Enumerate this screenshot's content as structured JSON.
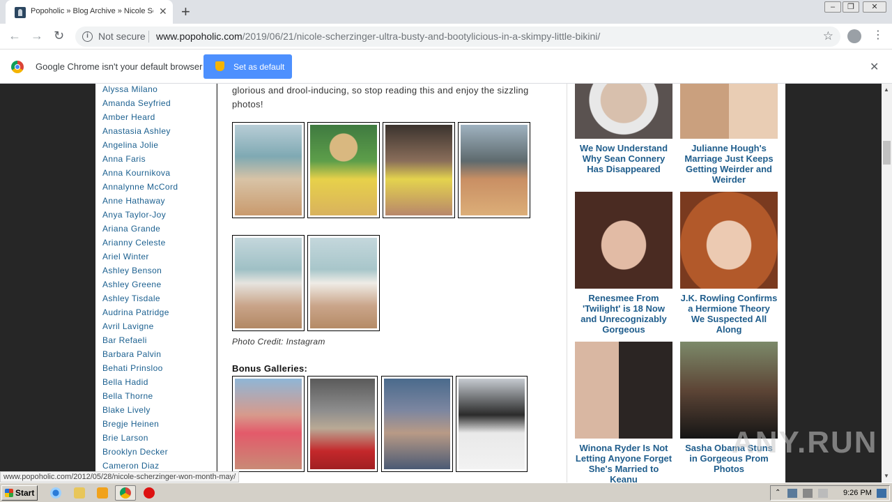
{
  "browser": {
    "tab_title": "Popoholic » Blog Archive » Nicole Scherzinger",
    "new_tab_symbol": "+",
    "close_symbol": "✕",
    "security_text": "Not secure",
    "url_domain": "www.popoholic.com",
    "url_path": "/2019/06/21/nicole-scherzinger-ultra-busty-and-bootylicious-in-a-skimpy-little-bikini/"
  },
  "infobar": {
    "message": "Google Chrome isn't your default browser",
    "button_label": "Set as default"
  },
  "sidebar": {
    "items": [
      "Alyssa Milano",
      "Amanda Seyfried",
      "Amber Heard",
      "Anastasia Ashley",
      "Angelina Jolie",
      "Anna Faris",
      "Anna Kournikova",
      "Annalynne McCord",
      "Anne Hathaway",
      "Anya Taylor-Joy",
      "Ariana Grande",
      "Arianny Celeste",
      "Ariel Winter",
      "Ashley Benson",
      "Ashley Greene",
      "Ashley Tisdale",
      "Audrina Patridge",
      "Avril Lavigne",
      "Bar Refaeli",
      "Barbara Palvin",
      "Behati Prinsloo",
      "Bella Hadid",
      "Bella Thorne",
      "Blake Lively",
      "Bregje Heinen",
      "Brie Larson",
      "Brooklyn Decker",
      "Cameron Diaz"
    ]
  },
  "content": {
    "intro": "glorious and drool-inducing, so stop reading this and enjoy the sizzling photos!",
    "photo_credit": "Photo Credit: Instagram",
    "bonus_heading": "Bonus Galleries:"
  },
  "ads": [
    {
      "caption": "We Now Understand Why Sean Connery Has Disappeared"
    },
    {
      "caption": "Julianne Hough's Marriage Just Keeps Getting Weirder and Weirder"
    },
    {
      "caption": "Renesmee From 'Twilight' is 18 Now and Unrecognizably Gorgeous"
    },
    {
      "caption": "J.K. Rowling Confirms a Hermione Theory We Suspected All Along"
    },
    {
      "caption": "Winona Ryder Is Not Letting Anyone Forget She's Married to Keanu"
    },
    {
      "caption": "Sasha Obama Stuns in Gorgeous Prom Photos"
    }
  ],
  "status_link": "www.popoholic.com/2012/05/28/nicole-scherzinger-won-month-may/",
  "watermark": "ANY.RUN",
  "taskbar": {
    "start_label": "Start",
    "clock": "9:26 PM"
  }
}
